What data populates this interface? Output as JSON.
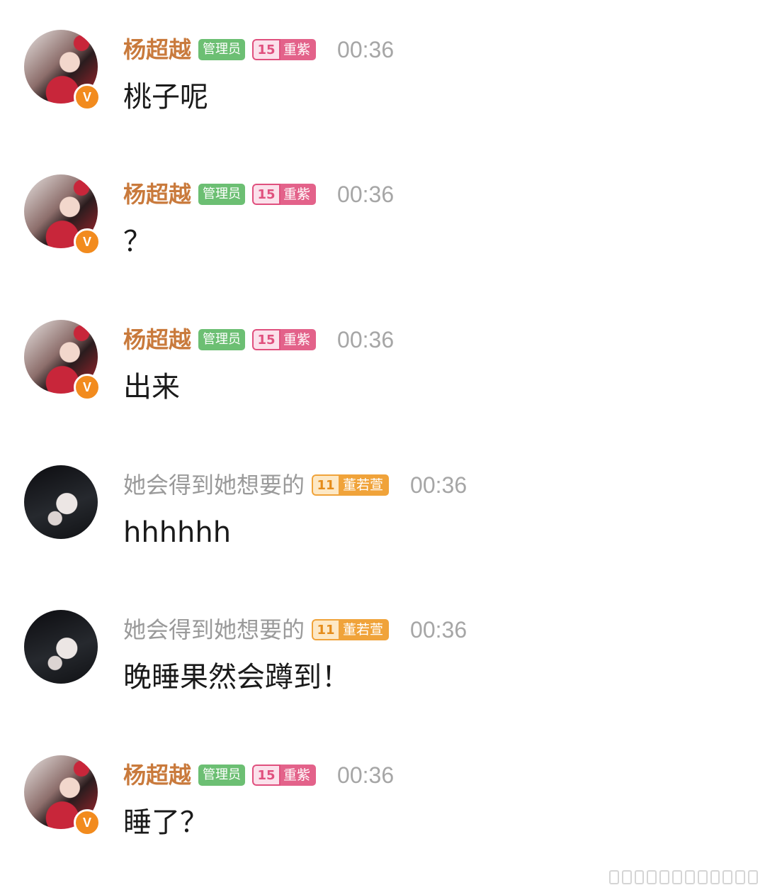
{
  "messages": [
    {
      "name": "杨超越",
      "role": "admin",
      "admin_tag": "管理员",
      "level": "15",
      "fan_tag": "重紫",
      "time": "00:36",
      "text": "桃子呢",
      "avatar": "avatar-red"
    },
    {
      "name": "杨超越",
      "role": "admin",
      "admin_tag": "管理员",
      "level": "15",
      "fan_tag": "重紫",
      "time": "00:36",
      "text": "？",
      "avatar": "avatar-red"
    },
    {
      "name": "杨超越",
      "role": "admin",
      "admin_tag": "管理员",
      "level": "15",
      "fan_tag": "重紫",
      "time": "00:36",
      "text": "出来",
      "avatar": "avatar-red"
    },
    {
      "name": "她会得到她想要的",
      "role": "member",
      "level": "11",
      "fan_tag": "董若萱",
      "time": "00:36",
      "text": "hhhhhh",
      "avatar": "avatar-dark"
    },
    {
      "name": "她会得到她想要的",
      "role": "member",
      "level": "11",
      "fan_tag": "董若萱",
      "time": "00:36",
      "text": "晚睡果然会蹲到！",
      "avatar": "avatar-dark"
    },
    {
      "name": "杨超越",
      "role": "admin",
      "admin_tag": "管理员",
      "level": "15",
      "fan_tag": "重紫",
      "time": "00:36",
      "text": "睡了？",
      "avatar": "avatar-red"
    }
  ],
  "verified_badge": "V",
  "colors": {
    "admin_name": "#c97a3c",
    "member_name": "#9a9a9a",
    "admin_tag_bg": "#6cbf73",
    "level_pink": "#e3628a",
    "level_orange": "#f0a33a",
    "verified_badge": "#f28b1e"
  }
}
